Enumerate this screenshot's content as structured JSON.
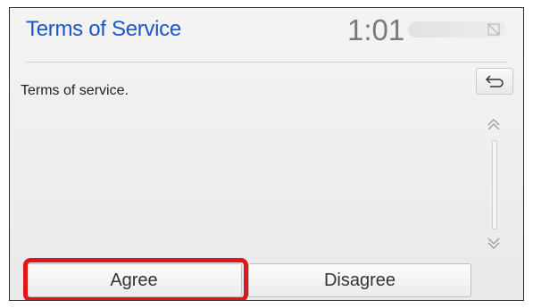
{
  "header": {
    "title": "Terms of Service",
    "clock": "1:01"
  },
  "body": {
    "message": "Terms of service."
  },
  "icons": {
    "back": "back-arrow-icon",
    "scroll_up": "double-chevron-up-icon",
    "scroll_down": "double-chevron-down-icon",
    "status": "no-signal-icon"
  },
  "buttons": {
    "agree": "Agree",
    "disagree": "Disagree"
  },
  "colors": {
    "title": "#1a56c8",
    "highlight": "#e1161c"
  }
}
